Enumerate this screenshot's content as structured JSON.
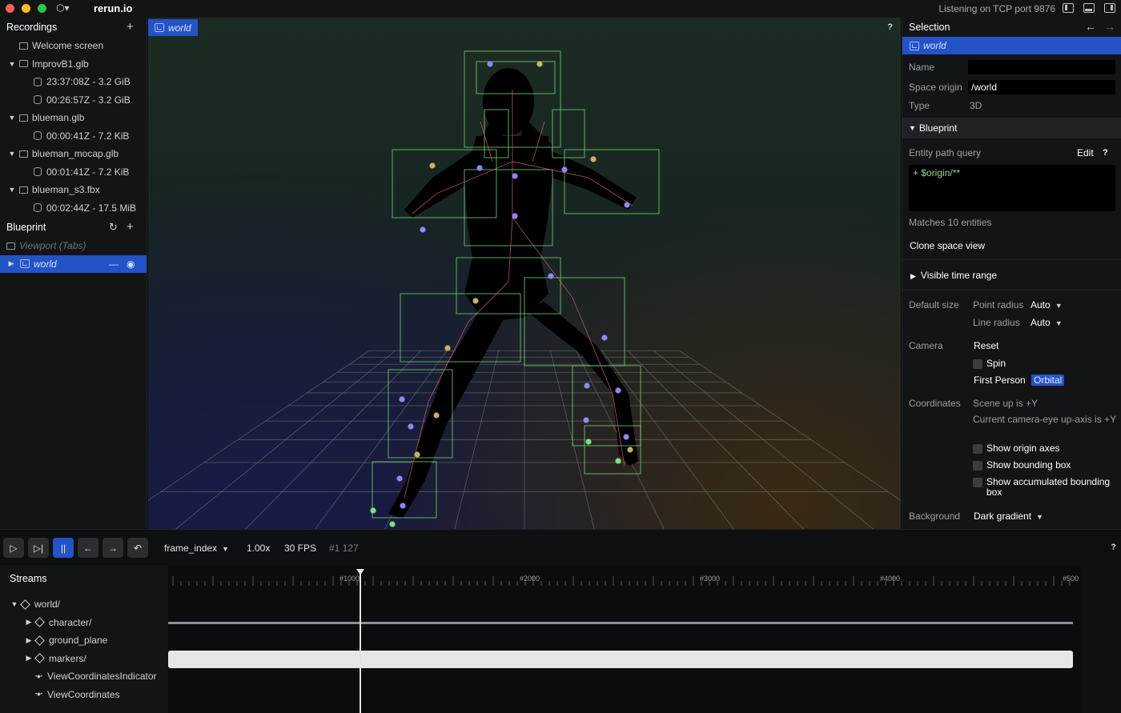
{
  "titlebar": {
    "app_title": "rerun.io",
    "menu_icon": "rerun-logo-icon",
    "tcp_status": "Listening on TCP port 9876"
  },
  "recordings": {
    "header": "Recordings",
    "items": [
      {
        "label": "Welcome screen"
      },
      {
        "label": "ImprovB1.glb",
        "children": [
          "23:37:08Z - 3.2 GiB",
          "00:26:57Z - 3.2 GiB"
        ]
      },
      {
        "label": "blueman.glb",
        "children": [
          "00:00:41Z - 7.2 KiB"
        ]
      },
      {
        "label": "blueman_mocap.glb",
        "children": [
          "00:01:41Z - 7.2 KiB"
        ]
      },
      {
        "label": "blueman_s3.fbx",
        "children": [
          "00:02:44Z - 17.5 MiB"
        ]
      }
    ]
  },
  "blueprint_panel": {
    "header": "Blueprint",
    "viewport_label": "Viewport (Tabs)",
    "world_label": "world"
  },
  "viewport": {
    "tab_label": "world",
    "help": "?"
  },
  "selection": {
    "header": "Selection",
    "item": "world",
    "name_label": "Name",
    "name_value": "",
    "space_origin_label": "Space origin",
    "space_origin_value": "/world",
    "type_label": "Type",
    "type_value": "3D",
    "blueprint_header": "Blueprint",
    "entity_query_label": "Entity path query",
    "edit_label": "Edit",
    "help": "?",
    "query_value": "+ $origin/**",
    "matches": "Matches 10 entities",
    "clone_label": "Clone space view",
    "visible_time_range": "Visible time range",
    "default_size_label": "Default size",
    "point_radius_label": "Point radius",
    "point_radius_value": "Auto",
    "line_radius_label": "Line radius",
    "line_radius_value": "Auto",
    "camera_label": "Camera",
    "reset_label": "Reset",
    "spin_label": "Spin",
    "first_person_label": "First Person",
    "orbital_label": "Orbital",
    "coordinates_label": "Coordinates",
    "scene_up": "Scene up is +Y",
    "camera_eye_up": "Current camera-eye up-axis is +Y",
    "show_origin_axes": "Show origin axes",
    "show_bounding_box": "Show bounding box",
    "show_accum_bbox": "Show accumulated bounding box",
    "background_label": "Background",
    "background_value": "Dark gradient"
  },
  "timeline": {
    "timeline_name": "frame_index",
    "speed": "1.00x",
    "fps": "30 FPS",
    "frame": "#1 127",
    "help": "?",
    "streams_title": "Streams",
    "ticks": [
      "#1000",
      "#2000",
      "#3000",
      "#4000",
      "#500"
    ],
    "streams": [
      {
        "label": "world/",
        "depth": 0,
        "expanded": true,
        "kind": "entity"
      },
      {
        "label": "character/",
        "depth": 1,
        "expanded": false,
        "kind": "entity"
      },
      {
        "label": "ground_plane",
        "depth": 1,
        "expanded": false,
        "kind": "entity"
      },
      {
        "label": "markers/",
        "depth": 1,
        "expanded": false,
        "kind": "entity"
      },
      {
        "label": "ViewCoordinatesIndicator",
        "depth": 1,
        "kind": "component"
      },
      {
        "label": "ViewCoordinates",
        "depth": 1,
        "kind": "component"
      }
    ]
  },
  "colors": {
    "accent": "#2453c8",
    "panel_bg": "#121416",
    "query_text": "#8ed98e"
  }
}
